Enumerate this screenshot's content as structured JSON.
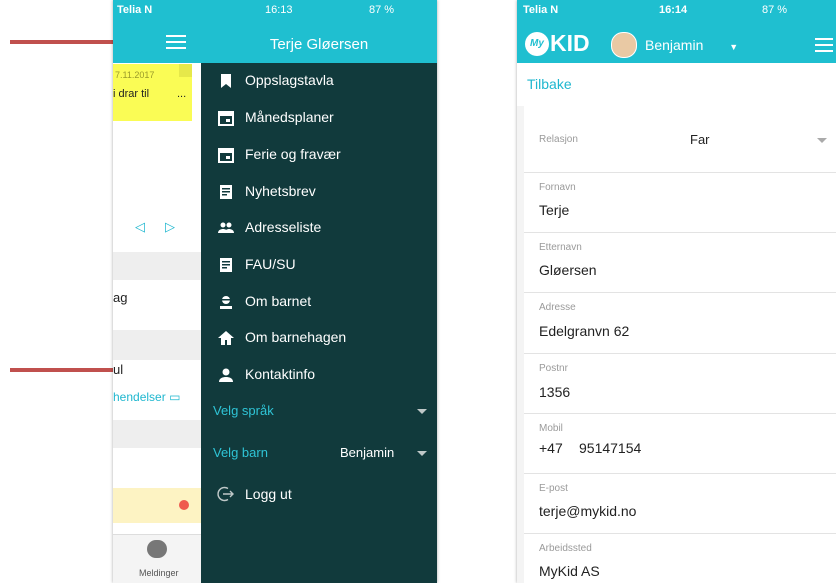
{
  "left": {
    "status": {
      "carrier": "Telia N",
      "time": "16:13",
      "battery": "87 %"
    },
    "background": {
      "sticky_date": "7.11.2017",
      "sticky_text": "i drar til",
      "sticky_more": "...",
      "row1_text": "ag",
      "row2_text": "ul",
      "row2_link": "hendelser",
      "bottom_tab_label": "Meldinger"
    },
    "drawer": {
      "user_name": "Terje Gløersen",
      "items": [
        {
          "label": "Oppslagstavla",
          "icon": "bookmark-icon"
        },
        {
          "label": "Månedsplaner",
          "icon": "calendar-icon"
        },
        {
          "label": "Ferie og fravær",
          "icon": "calendar-icon"
        },
        {
          "label": "Nyhetsbrev",
          "icon": "document-icon"
        },
        {
          "label": "Adresseliste",
          "icon": "people-icon"
        },
        {
          "label": "FAU/SU",
          "icon": "document-icon"
        },
        {
          "label": "Om barnet",
          "icon": "child-icon"
        },
        {
          "label": "Om barnehagen",
          "icon": "home-icon"
        },
        {
          "label": "Kontaktinfo",
          "icon": "person-icon"
        }
      ],
      "language_label": "Velg språk",
      "child_label": "Velg barn",
      "child_value": "Benjamin",
      "logout_label": "Logg ut"
    }
  },
  "right": {
    "status": {
      "carrier": "Telia N",
      "time": "16:14",
      "battery": "87 %"
    },
    "header": {
      "logo_text": "KID",
      "logo_badge": "My",
      "child_name": "Benjamin"
    },
    "back_label": "Tilbake",
    "fields": [
      {
        "label": "Relasjon",
        "value": "Far"
      },
      {
        "label": "Fornavn",
        "value": "Terje"
      },
      {
        "label": "Etternavn",
        "value": "Gløersen"
      },
      {
        "label": "Adresse",
        "value": "Edelgranvn 62"
      },
      {
        "label": "Postnr",
        "value": "1356"
      },
      {
        "label": "Mobil",
        "prefix": "+47",
        "value": "95147154"
      },
      {
        "label": "E-post",
        "value": "terje@mykid.no"
      },
      {
        "label": "Arbeidssted",
        "value": "MyKid AS"
      }
    ]
  },
  "colors": {
    "teal": "#1fbfd0",
    "drawer": "#113a3c",
    "arrow": "#c0504d",
    "sticky": "#fafc55"
  }
}
